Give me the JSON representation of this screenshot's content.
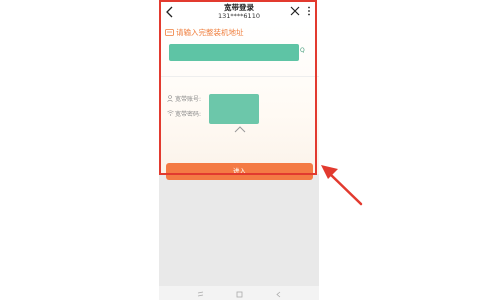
{
  "header": {
    "title": "宽带登录",
    "subtitle": "131****6110"
  },
  "address": {
    "prompt": "请输入完整装机地址",
    "tail": "Q"
  },
  "credentials": {
    "account_label": "宽带账号:",
    "password_label": "宽带密码:"
  },
  "actions": {
    "enter_label": "进入"
  },
  "icons": {
    "back": "chevron-left-icon",
    "close": "close-icon",
    "more": "more-vertical-icon",
    "address": "address-card-icon",
    "account": "user-icon",
    "password": "wifi-icon",
    "expand": "chevron-up-icon",
    "nav_menu": "menu-icon",
    "nav_home": "home-icon",
    "nav_back": "back-icon"
  },
  "colors": {
    "accent": "#f47a44",
    "highlight": "#e23a2f",
    "redaction": "#5ec4a5"
  }
}
